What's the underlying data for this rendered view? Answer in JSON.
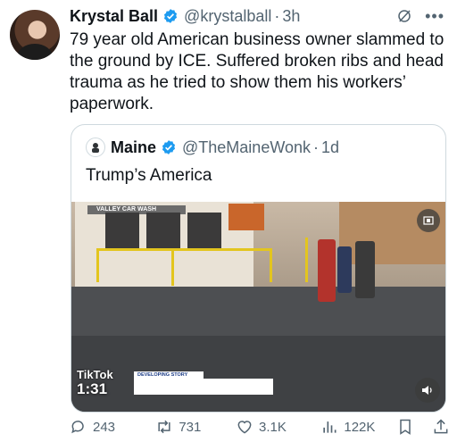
{
  "post": {
    "author_name": "Krystal Ball",
    "author_handle": "@krystalball",
    "separator": "·",
    "time": "3h",
    "text": "79 year old American business owner slammed to the ground by ICE. Suffered broken ribs and head trauma as he tried to show them his workers’ paperwork."
  },
  "quoted_post": {
    "author_name": "Maine",
    "author_handle": "@TheMaineWonk",
    "separator": "·",
    "time": "1d",
    "text": "Trump’s America",
    "video": {
      "sign_text": "VALLEY CAR WASH",
      "overlay_label": "DEVELOPING STORY",
      "timer": "1:31",
      "watermark": "TikTok"
    }
  },
  "actions": {
    "replies": "243",
    "reposts": "731",
    "likes": "3.1K",
    "views": "122K"
  },
  "colors": {
    "verified": "#1d9bf0",
    "text": "#0f1419",
    "muted": "#536471",
    "border": "#cfd9de"
  },
  "icons": [
    "verified-badge-icon",
    "grok-icon",
    "more-icon",
    "reply-icon",
    "repost-icon",
    "like-icon",
    "views-icon",
    "bookmark-icon",
    "share-icon",
    "sound-icon",
    "expand-icon"
  ]
}
